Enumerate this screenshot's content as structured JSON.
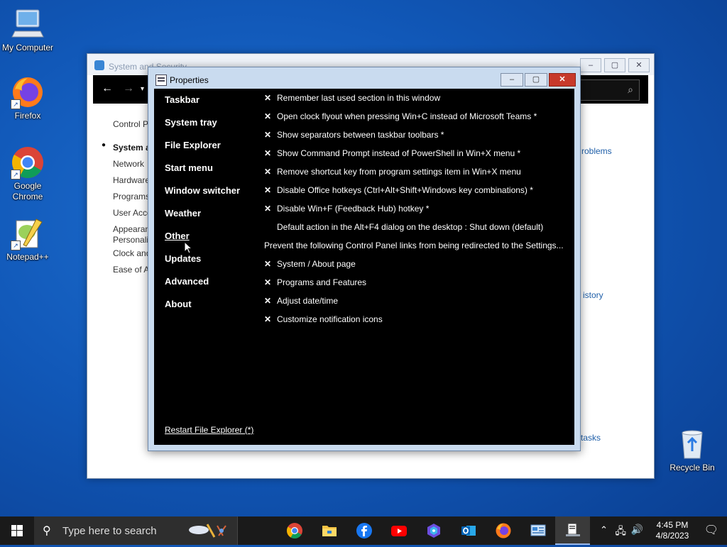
{
  "desktop": {
    "icons": [
      {
        "label": "My Computer"
      },
      {
        "label": "Firefox"
      },
      {
        "label": "Google Chrome"
      },
      {
        "label": "Notepad++"
      },
      {
        "label": "Recycle Bin"
      }
    ]
  },
  "control_panel": {
    "title": "System and Security",
    "sidebar": [
      "Control P",
      "System a",
      "Network",
      "Hardware",
      "Programs",
      "User Acco",
      "Appearan",
      "Personali",
      "Clock and",
      "Ease of A"
    ],
    "right_links": [
      "roblems",
      "istory",
      "tasks"
    ]
  },
  "properties": {
    "title": "Properties",
    "menu": [
      "Taskbar",
      "System tray",
      "File Explorer",
      "Start menu",
      "Window switcher",
      "Weather",
      "Other",
      "Updates",
      "Advanced",
      "About"
    ],
    "selected": "Other",
    "options": [
      {
        "mark": "✕",
        "text": "Remember last used section in this window"
      },
      {
        "mark": "✕",
        "text": "Open clock flyout when pressing Win+C instead of Microsoft Teams *"
      },
      {
        "mark": "✕",
        "text": "Show separators between taskbar toolbars *"
      },
      {
        "mark": "✕",
        "text": "Show Command Prompt instead of PowerShell in Win+X menu *"
      },
      {
        "mark": "✕",
        "text": "Remove shortcut key from program settings item in Win+X menu"
      },
      {
        "mark": "✕",
        "text": "Disable Office hotkeys (Ctrl+Alt+Shift+Windows key combinations) *"
      },
      {
        "mark": "✕",
        "text": "Disable Win+F (Feedback Hub) hotkey *"
      },
      {
        "mark": "",
        "text": "Default action in the Alt+F4 dialog on the desktop : Shut down (default)",
        "indent": true
      },
      {
        "mark": "",
        "text": "Prevent the following Control Panel links from being redirected to the Settings...",
        "indent": false
      },
      {
        "mark": "✕",
        "text": "System / About page"
      },
      {
        "mark": "✕",
        "text": "Programs and Features"
      },
      {
        "mark": "✕",
        "text": "Adjust date/time"
      },
      {
        "mark": "✕",
        "text": "Customize notification icons"
      }
    ],
    "restart_label": "Restart File Explorer (*)"
  },
  "taskbar": {
    "search_placeholder": "Type here to search",
    "time": "4:45 PM",
    "date": "4/8/2023"
  }
}
